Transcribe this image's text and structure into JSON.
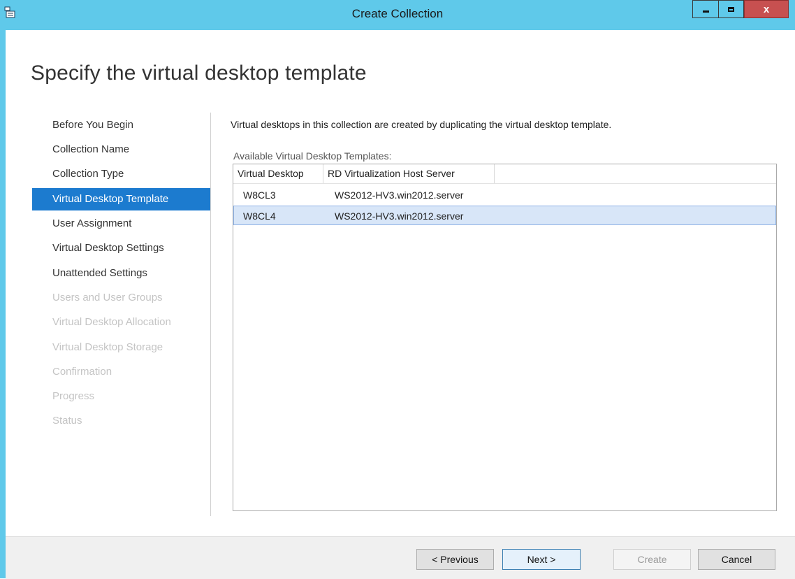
{
  "window": {
    "title": "Create Collection",
    "icon": "collection-wizard-icon",
    "controls": {
      "minimize": "minimize-icon",
      "maximize": "maximize-icon",
      "close": "x"
    }
  },
  "page": {
    "title": "Specify the virtual desktop template"
  },
  "nav": {
    "items": [
      {
        "label": "Before You Begin",
        "state": "normal"
      },
      {
        "label": "Collection Name",
        "state": "normal"
      },
      {
        "label": "Collection Type",
        "state": "normal"
      },
      {
        "label": "Virtual Desktop Template",
        "state": "active"
      },
      {
        "label": "User Assignment",
        "state": "normal"
      },
      {
        "label": "Virtual Desktop Settings",
        "state": "normal"
      },
      {
        "label": "Unattended Settings",
        "state": "normal"
      },
      {
        "label": "Users and User Groups",
        "state": "disabled"
      },
      {
        "label": "Virtual Desktop Allocation",
        "state": "disabled"
      },
      {
        "label": "Virtual Desktop Storage",
        "state": "disabled"
      },
      {
        "label": "Confirmation",
        "state": "disabled"
      },
      {
        "label": "Progress",
        "state": "disabled"
      },
      {
        "label": "Status",
        "state": "disabled"
      }
    ]
  },
  "main": {
    "description": "Virtual desktops in this collection are created by duplicating the virtual desktop template.",
    "list_label": "Available Virtual Desktop Templates:",
    "columns": [
      "Virtual Desktop",
      "RD Virtualization Host Server"
    ],
    "rows": [
      {
        "desktop": "W8CL3",
        "host": "WS2012-HV3.win2012.server",
        "selected": false
      },
      {
        "desktop": "W8CL4",
        "host": "WS2012-HV3.win2012.server",
        "selected": true
      }
    ]
  },
  "buttons": {
    "previous": "< Previous",
    "next": "Next >",
    "create": "Create",
    "cancel": "Cancel"
  },
  "colors": {
    "titlebar": "#5fc9ea",
    "nav_active": "#1c7bcf",
    "selected_row": "#d8e6f8",
    "close_button": "#c75050"
  }
}
